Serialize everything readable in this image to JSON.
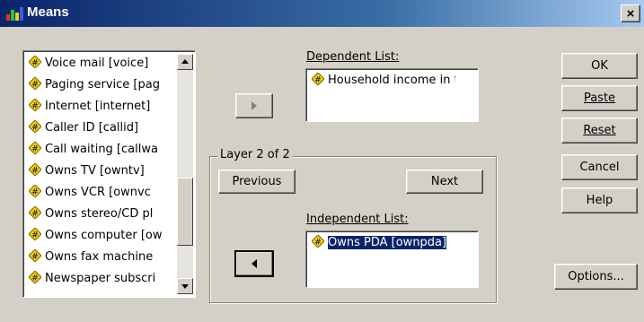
{
  "window": {
    "title": "Means",
    "close_label": "×"
  },
  "source_list": {
    "items": [
      "Voice mail [voice]",
      "Paging service [pag",
      "Internet [internet]",
      "Caller ID [callid]",
      "Call waiting [callwa",
      "Owns TV [owntv]",
      "Owns VCR [ownvc",
      "Owns stereo/CD pl",
      "Owns computer [ow",
      "Owns fax machine",
      "Newspaper subscri"
    ]
  },
  "dependent": {
    "label": "Dependent List:",
    "items": [
      "Household income in tl"
    ]
  },
  "layer": {
    "label": "Layer 2 of 2",
    "previous_label": "Previous",
    "next_label": "Next"
  },
  "independent": {
    "label": "Independent List:",
    "items": [
      "Owns PDA [ownpda]"
    ]
  },
  "buttons": {
    "ok": "OK",
    "paste": "Paste",
    "reset": "Reset",
    "cancel": "Cancel",
    "help": "Help",
    "options": "Options..."
  },
  "colors": {
    "accent": "#0a246a",
    "face": "#d4d0c8",
    "icon_fill": "#f0d000"
  }
}
